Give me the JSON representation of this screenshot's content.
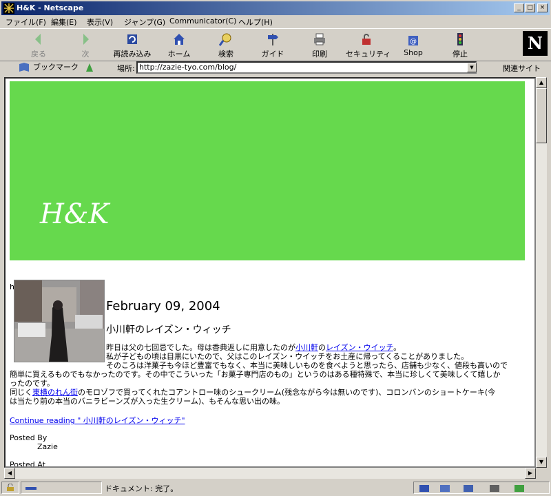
{
  "window": {
    "title": "H&K - Netscape"
  },
  "menu": [
    "ファイル(F)",
    "編集(E)",
    "表示(V)",
    "ジャンプ(G)",
    "Communicator(C)",
    "ヘルプ(H)"
  ],
  "toolbar": {
    "back": "戻る",
    "forward": "次",
    "reload": "再読み込み",
    "home": "ホーム",
    "search": "検索",
    "guide": "ガイド",
    "print": "印刷",
    "security": "セキュリティ",
    "shop": "Shop",
    "stop": "停止",
    "logo": "N"
  },
  "location": {
    "bookmarks": "ブックマーク",
    "label": "場所:",
    "url": "http://zazie-tyo.com/blog/",
    "related": "関連サイト"
  },
  "page": {
    "banner_logo": "H&K",
    "stray_char": "h",
    "date": "February 09, 2004",
    "title": "小川軒のレイズン・ウィッチ",
    "body1_pre": "昨日は父の七回忌でした。母は香典返しに用意したのが",
    "body1_link1": "小川軒",
    "body1_mid": "の",
    "body1_link2": "レイズン・ウイッチ",
    "body1_post": "。",
    "body2": "私が子どもの頃は目黒にいたので、父はこのレイズン・ウイッチをお土産に帰ってくることがありました。",
    "body3a": "そのころは洋菓子も今ほど豊富でもなく、本当に美味しいものを食べようと思ったら、店舗も少なく、値段も高いので",
    "body3b": "簡単に買えるものでもなかったのです。その中でこういった「お菓子専門店のもの」というのはある種特殊で、本当に珍しくて美味しくて嬉しか",
    "body3c": "ったのです。",
    "body4_pre": "同じく",
    "body4_link": "東横のれん街",
    "body4_post": "のモロゾフで買ってくれたコアントロー味のシュークリーム(残念ながら今は無いのです)、コロンバンのショートケーキ(今",
    "body5": "は当たり前の本当のバニラビーンズが入った生クリーム)、もそんな思い出の味。",
    "continue": "Continue reading \" 小川軒のレイズン・ウィッチ\"",
    "posted_by_label": "Posted By",
    "posted_by": "Zazie",
    "posted_at_label": "Posted At"
  },
  "status": {
    "text": "ドキュメント: 完了。"
  },
  "colors": {
    "banner": "#66d94d",
    "titlebar": "#0a246a",
    "link": "#0000ee"
  }
}
